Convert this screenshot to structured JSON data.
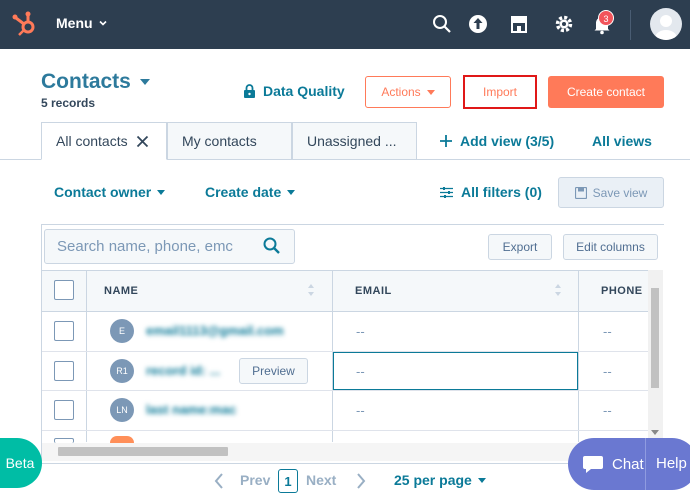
{
  "nav": {
    "menu_label": "Menu",
    "notification_count": "3",
    "colors": {
      "bg": "#2d3e50",
      "logo": "#ff7a59"
    }
  },
  "header": {
    "title": "Contacts",
    "records": "5 records",
    "data_quality": "Data Quality",
    "actions": "Actions",
    "import": "Import",
    "create": "Create contact"
  },
  "tabs": [
    {
      "label": "All contacts"
    },
    {
      "label": "My contacts"
    },
    {
      "label": "Unassigned ..."
    }
  ],
  "add_view": "Add view (3/5)",
  "all_views": "All views",
  "filters": {
    "owner": "Contact owner",
    "date": "Create date",
    "all_filters": "All filters (0)",
    "save_view": "Save view"
  },
  "table": {
    "search_placeholder": "Search name, phone, emc",
    "export": "Export",
    "edit_columns": "Edit columns",
    "columns": [
      "NAME",
      "EMAIL",
      "PHONE"
    ],
    "rows": [
      {
        "initials": "E",
        "name": "email1113@gmail.com",
        "email": "--",
        "phone": "--"
      },
      {
        "initials": "R1",
        "name": "record id: ...",
        "email": "--",
        "phone": "--",
        "preview": "Preview"
      },
      {
        "initials": "LN",
        "name": "last name:mac",
        "email": "--",
        "phone": "--"
      }
    ]
  },
  "pagination": {
    "prev": "Prev",
    "page": "1",
    "next": "Next",
    "per_page": "25 per page"
  },
  "floating": {
    "beta": "Beta",
    "chat": "Chat",
    "help": "Help"
  }
}
